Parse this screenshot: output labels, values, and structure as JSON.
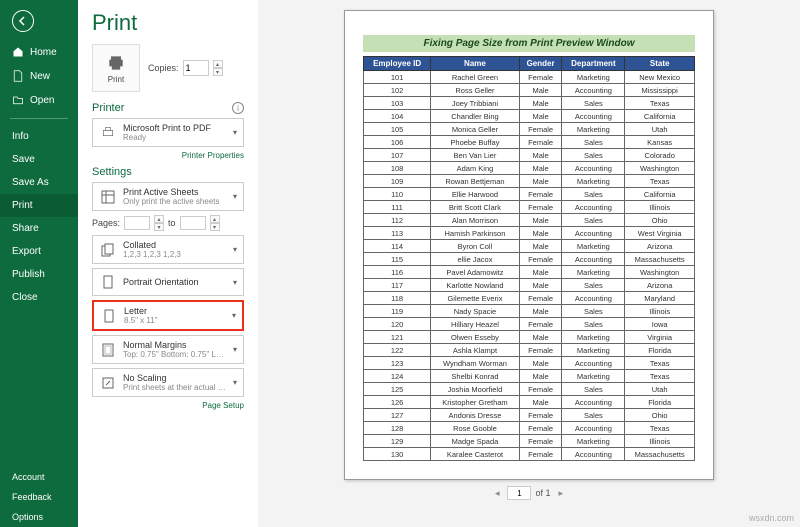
{
  "sidebar": {
    "home": "Home",
    "new": "New",
    "open": "Open",
    "info": "Info",
    "save": "Save",
    "saveAs": "Save As",
    "print": "Print",
    "share": "Share",
    "export": "Export",
    "publish": "Publish",
    "close": "Close",
    "account": "Account",
    "feedback": "Feedback",
    "options": "Options"
  },
  "header": {
    "title": "Print"
  },
  "printBtn": {
    "label": "Print"
  },
  "copies": {
    "label": "Copies:",
    "value": "1"
  },
  "printerSection": {
    "label": "Printer"
  },
  "printer": {
    "name": "Microsoft Print to PDF",
    "status": "Ready",
    "propsLink": "Printer Properties"
  },
  "settingsSection": {
    "label": "Settings"
  },
  "settings": {
    "sheets": {
      "title": "Print Active Sheets",
      "sub": "Only print the active sheets"
    },
    "pagesLabel": "Pages:",
    "pagesTo": "to",
    "collated": {
      "title": "Collated",
      "sub": "1,2,3   1,2,3   1,2,3"
    },
    "orientation": {
      "title": "Portrait Orientation"
    },
    "paper": {
      "title": "Letter",
      "sub": "8.5\" x 11\""
    },
    "margins": {
      "title": "Normal Margins",
      "sub": "Top: 0.75\" Bottom: 0.75\" Lef…"
    },
    "scaling": {
      "title": "No Scaling",
      "sub": "Print sheets at their actual size"
    },
    "pageSetupLink": "Page Setup"
  },
  "preview": {
    "title": "Fixing Page Size from Print Preview Window",
    "headers": [
      "Employee ID",
      "Name",
      "Gender",
      "Department",
      "State"
    ],
    "rows": [
      [
        "101",
        "Rachel Green",
        "Female",
        "Marketing",
        "New Mexico"
      ],
      [
        "102",
        "Ross Geller",
        "Male",
        "Accounting",
        "Mississippi"
      ],
      [
        "103",
        "Joey Tribbiani",
        "Male",
        "Sales",
        "Texas"
      ],
      [
        "104",
        "Chandler Bing",
        "Male",
        "Accounting",
        "California"
      ],
      [
        "105",
        "Monica Geller",
        "Female",
        "Marketing",
        "Utah"
      ],
      [
        "106",
        "Phoebe Buffay",
        "Female",
        "Sales",
        "Kansas"
      ],
      [
        "107",
        "Ben Van Lier",
        "Male",
        "Sales",
        "Colorado"
      ],
      [
        "108",
        "Adam King",
        "Male",
        "Accounting",
        "Washington"
      ],
      [
        "109",
        "Rowan Bettjeman",
        "Male",
        "Marketing",
        "Texas"
      ],
      [
        "110",
        "Ellie Harwood",
        "Female",
        "Sales",
        "California"
      ],
      [
        "111",
        "Britt Scott Clark",
        "Female",
        "Accounting",
        "Illinois"
      ],
      [
        "112",
        "Alan Morrison",
        "Male",
        "Sales",
        "Ohio"
      ],
      [
        "113",
        "Hamish Parkinson",
        "Male",
        "Accounting",
        "West Virginia"
      ],
      [
        "114",
        "Byron Coll",
        "Male",
        "Marketing",
        "Arizona"
      ],
      [
        "115",
        "ellie Jacox",
        "Female",
        "Accounting",
        "Massachusetts"
      ],
      [
        "116",
        "Pavel Adamowitz",
        "Male",
        "Marketing",
        "Washington"
      ],
      [
        "117",
        "Karlotte Nowland",
        "Male",
        "Sales",
        "Arizona"
      ],
      [
        "118",
        "Gilemette Everix",
        "Female",
        "Accounting",
        "Maryland"
      ],
      [
        "119",
        "Nady Spacie",
        "Male",
        "Sales",
        "Illinois"
      ],
      [
        "120",
        "Hilliary Heazel",
        "Female",
        "Sales",
        "Iowa"
      ],
      [
        "121",
        "Olwen Esseby",
        "Male",
        "Marketing",
        "Virginia"
      ],
      [
        "122",
        "Ashla Klampt",
        "Female",
        "Marketing",
        "Florida"
      ],
      [
        "123",
        "Wyndham Worman",
        "Male",
        "Accounting",
        "Texas"
      ],
      [
        "124",
        "Shelbi Konrad",
        "Male",
        "Marketing",
        "Texas"
      ],
      [
        "125",
        "Joshia Moorfield",
        "Female",
        "Sales",
        "Utah"
      ],
      [
        "126",
        "Kristopher Gretham",
        "Male",
        "Accounting",
        "Florida"
      ],
      [
        "127",
        "Andonis Dresse",
        "Female",
        "Sales",
        "Ohio"
      ],
      [
        "128",
        "Rose Gooble",
        "Female",
        "Accounting",
        "Texas"
      ],
      [
        "129",
        "Madge Spada",
        "Female",
        "Marketing",
        "Illinois"
      ],
      [
        "130",
        "Karalee Casterot",
        "Female",
        "Accounting",
        "Massachusetts"
      ]
    ]
  },
  "pageNav": {
    "current": "1",
    "ofLabel": "of 1"
  },
  "watermark": "wsxdn.com"
}
